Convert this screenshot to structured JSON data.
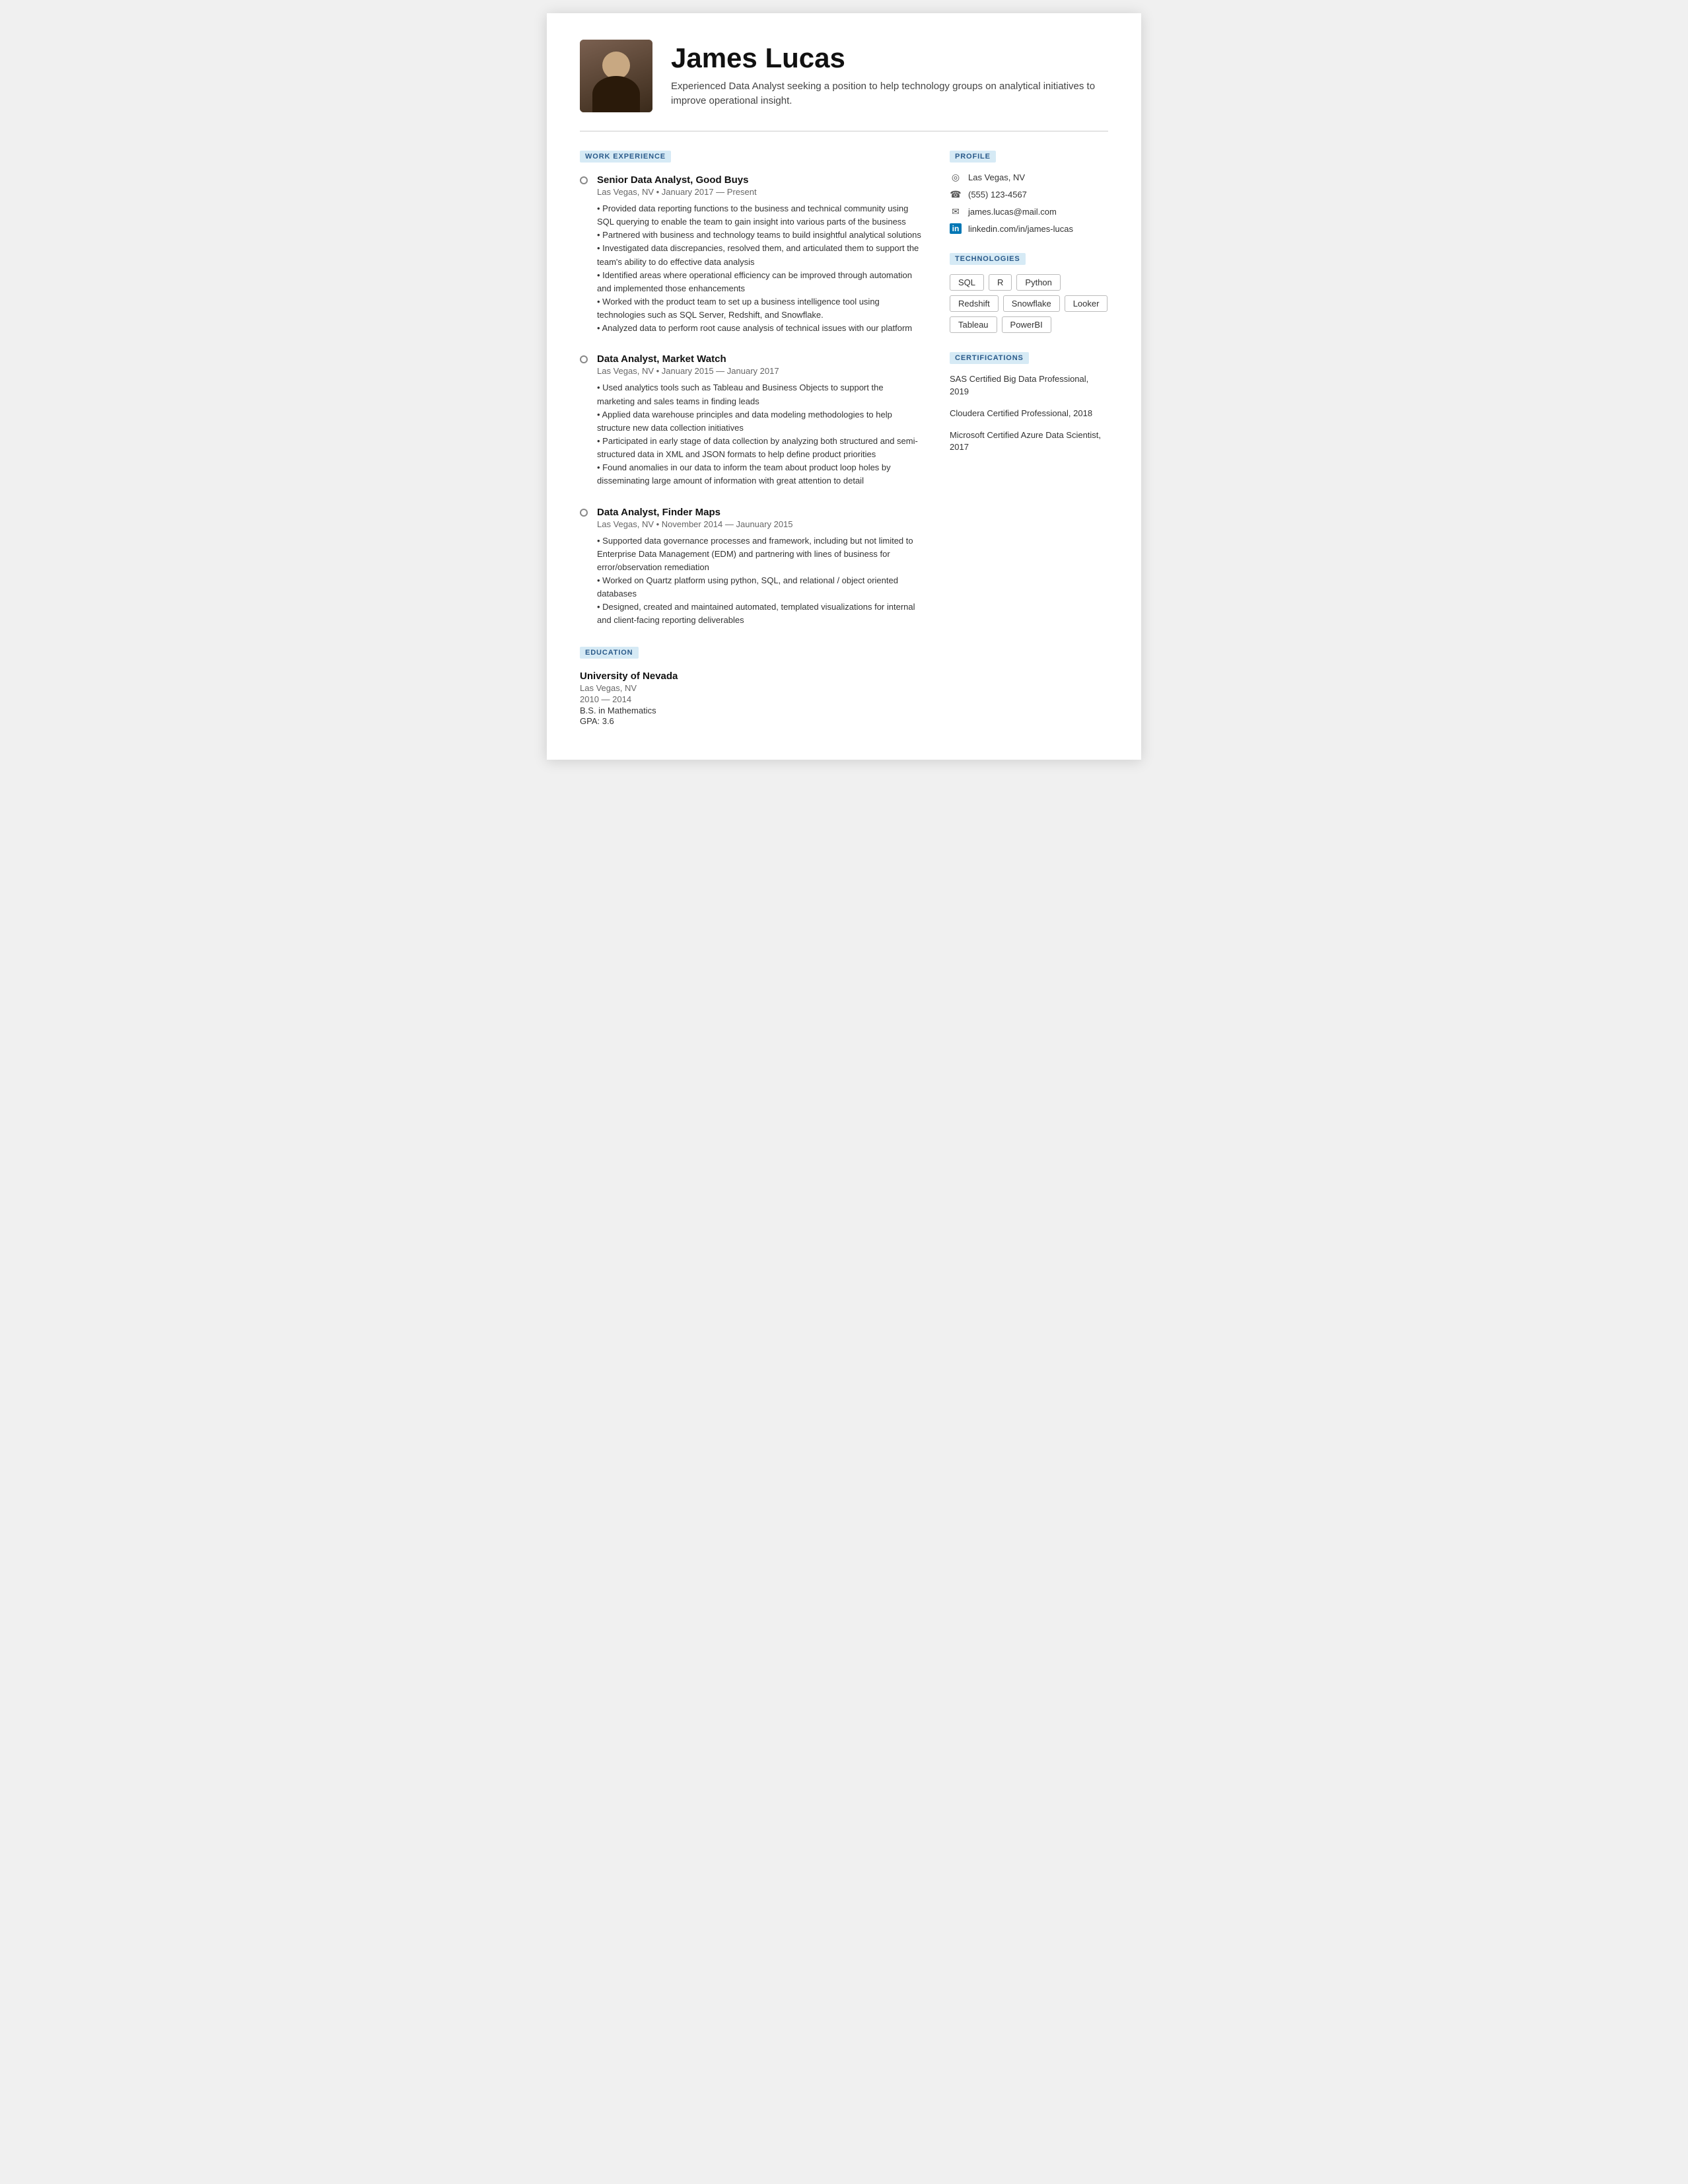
{
  "header": {
    "name": "James Lucas",
    "subtitle": "Experienced Data Analyst seeking a position to help technology groups on analytical initiatives to improve operational insight."
  },
  "sections": {
    "work_experience_label": "WORK EXPERIENCE",
    "education_label": "EDUCATION",
    "profile_label": "PROFILE",
    "technologies_label": "TECHNOLOGIES",
    "certifications_label": "CERTIFICATIONS"
  },
  "work_experience": [
    {
      "title": "Senior Data Analyst, Good Buys",
      "meta": "Las Vegas, NV • January 2017 — Present",
      "description": "• Provided data reporting functions to the business and technical community using SQL querying to enable the team to gain insight into various parts of the business\n• Partnered with business and technology teams to build insightful analytical solutions\n• Investigated data discrepancies, resolved them, and articulated them to support the team's ability to do effective data analysis\n• Identified areas where operational efficiency can be improved through automation and implemented those enhancements\n• Worked with the product team to set up a business intelligence tool using technologies such as SQL Server, Redshift, and Snowflake.\n• Analyzed data to perform root cause analysis of technical issues with our platform"
    },
    {
      "title": "Data Analyst, Market Watch",
      "meta": "Las Vegas, NV • January 2015 — January 2017",
      "description": "• Used analytics tools such as Tableau and Business Objects to support the marketing and sales teams in finding leads\n• Applied data warehouse principles and data modeling methodologies to help structure new data collection initiatives\n• Participated in early stage of data collection by analyzing both structured and semi-structured data in XML and JSON formats to help define product priorities\n• Found anomalies in our data to inform the team about product loop holes by disseminating large amount of information with great attention to detail"
    },
    {
      "title": "Data Analyst, Finder Maps",
      "meta": "Las Vegas, NV • November 2014 — Jaunuary 2015",
      "description": "• Supported data governance processes and framework, including but not limited to Enterprise Data Management (EDM) and partnering with lines of business for error/observation remediation\n• Worked on Quartz platform using python, SQL, and relational / object oriented databases\n• Designed, created and maintained automated, templated visualizations for internal and client-facing reporting deliverables"
    }
  ],
  "education": {
    "school": "University of Nevada",
    "location": "Las Vegas, NV",
    "years": "2010 — 2014",
    "degree": "B.S. in Mathematics",
    "gpa": "GPA: 3.6"
  },
  "profile": {
    "location": "Las Vegas, NV",
    "phone": "(555) 123-4567",
    "email": "james.lucas@mail.com",
    "linkedin": "linkedin.com/in/james-lucas"
  },
  "technologies": [
    "SQL",
    "R",
    "Python",
    "Redshift",
    "Snowflake",
    "Looker",
    "Tableau",
    "PowerBI"
  ],
  "certifications": [
    "SAS Certified Big Data Professional, 2019",
    "Cloudera Certified Professional, 2018",
    "Microsoft Certified Azure Data Scientist, 2017"
  ]
}
